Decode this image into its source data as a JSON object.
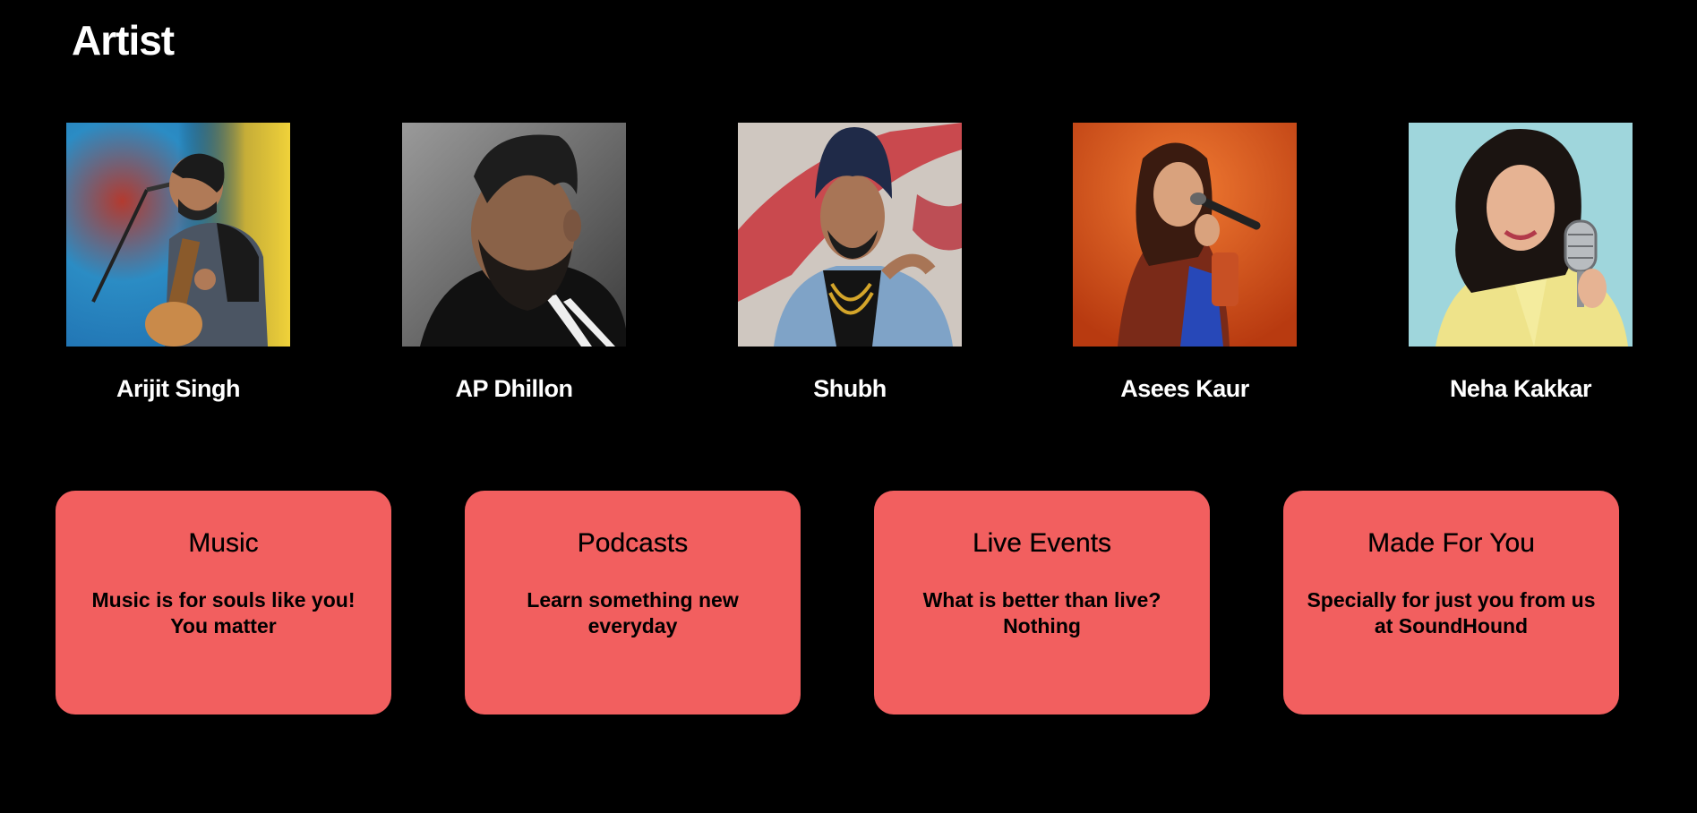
{
  "page": {
    "title": "Artist",
    "background": "#000000"
  },
  "artists": [
    {
      "name": "Arijit Singh",
      "photo_icon": "artist-photo-singer-with-guitar"
    },
    {
      "name": "AP Dhillon",
      "photo_icon": "artist-photo-portrait-bearded"
    },
    {
      "name": "Shubh",
      "photo_icon": "artist-photo-portrait-turban"
    },
    {
      "name": "Asees Kaur",
      "photo_icon": "artist-photo-singer-with-mic"
    },
    {
      "name": "Neha Kakkar",
      "photo_icon": "artist-photo-singer-with-vintage-mic"
    }
  ],
  "features": {
    "accent": "#f25f5f",
    "cards": [
      {
        "title": "Music",
        "description": "Music is for souls like you! You matter"
      },
      {
        "title": "Podcasts",
        "description": "Learn something new everyday"
      },
      {
        "title": "Live Events",
        "description": "What is better than live? Nothing"
      },
      {
        "title": "Made For You",
        "description": "Specially for just you from us at SoundHound"
      }
    ]
  }
}
